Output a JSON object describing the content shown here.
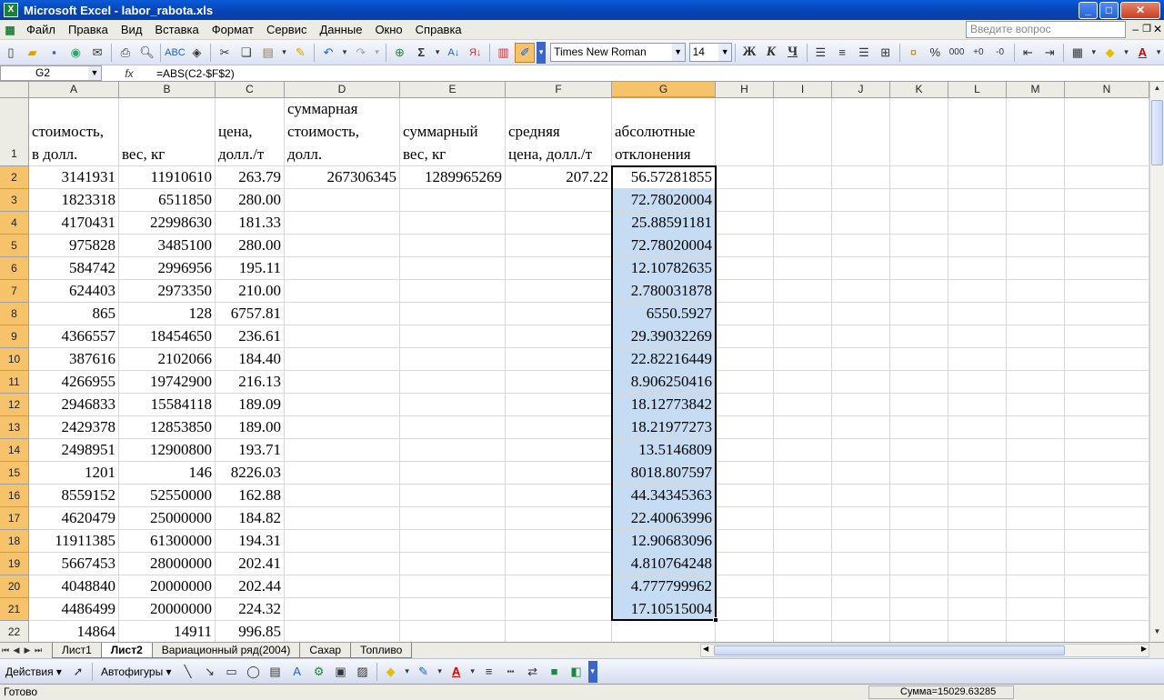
{
  "window": {
    "title": "Microsoft Excel - labor_rabota.xls",
    "minimize": "_",
    "maximize": "□",
    "close": "✕"
  },
  "menu": {
    "items": [
      "Файл",
      "Правка",
      "Вид",
      "Вставка",
      "Формат",
      "Сервис",
      "Данные",
      "Окно",
      "Справка"
    ],
    "help_placeholder": "Введите вопрос"
  },
  "toolbar": {
    "font": "Times New Roman",
    "size": "14",
    "bold": "Ж",
    "italic": "К",
    "underline": "Ч",
    "percent": "%",
    "thousands": "000"
  },
  "formula_bar": {
    "name_box": "G2",
    "fx": "fx",
    "formula": "=ABS(C2-$F$2)"
  },
  "grid": {
    "columns": [
      "A",
      "B",
      "C",
      "D",
      "E",
      "F",
      "G",
      "H",
      "I",
      "J",
      "K",
      "L",
      "M",
      "N"
    ],
    "selected_column": "G",
    "header_row": {
      "A": [
        "стоимость,",
        "в долл."
      ],
      "B": [
        "вес, кг"
      ],
      "C": [
        "цена,",
        "долл./т"
      ],
      "D": [
        "суммарная",
        "стоимость,",
        "долл."
      ],
      "E": [
        "суммарный",
        "вес, кг"
      ],
      "F": [
        "средняя",
        "цена, долл./т"
      ],
      "G": [
        "абсолютные",
        "отклонения"
      ]
    },
    "rows": [
      {
        "n": "2",
        "A": "3141931",
        "B": "11910610",
        "C": "263.79",
        "D": "267306345",
        "E": "1289965269",
        "F": "207.22",
        "G": "56.57281855"
      },
      {
        "n": "3",
        "A": "1823318",
        "B": "6511850",
        "C": "280.00",
        "G": "72.78020004"
      },
      {
        "n": "4",
        "A": "4170431",
        "B": "22998630",
        "C": "181.33",
        "G": "25.88591181"
      },
      {
        "n": "5",
        "A": "975828",
        "B": "3485100",
        "C": "280.00",
        "G": "72.78020004"
      },
      {
        "n": "6",
        "A": "584742",
        "B": "2996956",
        "C": "195.11",
        "G": "12.10782635"
      },
      {
        "n": "7",
        "A": "624403",
        "B": "2973350",
        "C": "210.00",
        "G": "2.780031878"
      },
      {
        "n": "8",
        "A": "865",
        "B": "128",
        "C": "6757.81",
        "G": "6550.5927"
      },
      {
        "n": "9",
        "A": "4366557",
        "B": "18454650",
        "C": "236.61",
        "G": "29.39032269"
      },
      {
        "n": "10",
        "A": "387616",
        "B": "2102066",
        "C": "184.40",
        "G": "22.82216449"
      },
      {
        "n": "11",
        "A": "4266955",
        "B": "19742900",
        "C": "216.13",
        "G": "8.906250416"
      },
      {
        "n": "12",
        "A": "2946833",
        "B": "15584118",
        "C": "189.09",
        "G": "18.12773842"
      },
      {
        "n": "13",
        "A": "2429378",
        "B": "12853850",
        "C": "189.00",
        "G": "18.21977273"
      },
      {
        "n": "14",
        "A": "2498951",
        "B": "12900800",
        "C": "193.71",
        "G": "13.5146809"
      },
      {
        "n": "15",
        "A": "1201",
        "B": "146",
        "C": "8226.03",
        "G": "8018.807597"
      },
      {
        "n": "16",
        "A": "8559152",
        "B": "52550000",
        "C": "162.88",
        "G": "44.34345363"
      },
      {
        "n": "17",
        "A": "4620479",
        "B": "25000000",
        "C": "184.82",
        "G": "22.40063996"
      },
      {
        "n": "18",
        "A": "11911385",
        "B": "61300000",
        "C": "194.31",
        "G": "12.90683096"
      },
      {
        "n": "19",
        "A": "5667453",
        "B": "28000000",
        "C": "202.41",
        "G": "4.810764248"
      },
      {
        "n": "20",
        "A": "4048840",
        "B": "20000000",
        "C": "202.44",
        "G": "4.777799962"
      },
      {
        "n": "21",
        "A": "4486499",
        "B": "20000000",
        "C": "224.32",
        "G": "17.10515004"
      },
      {
        "n": "22",
        "A": "14864",
        "B": "14911",
        "C": "996.85"
      }
    ]
  },
  "sheets": {
    "tabs": [
      "Лист1",
      "Лист2",
      "Вариационный ряд(2004)",
      "Сахар",
      "Топливо"
    ],
    "active": "Лист2"
  },
  "drawing_toolbar": {
    "actions": "Действия",
    "autoshapes": "Автофигуры"
  },
  "status": {
    "ready": "Готово",
    "sum": "Сумма=15029.63285"
  }
}
